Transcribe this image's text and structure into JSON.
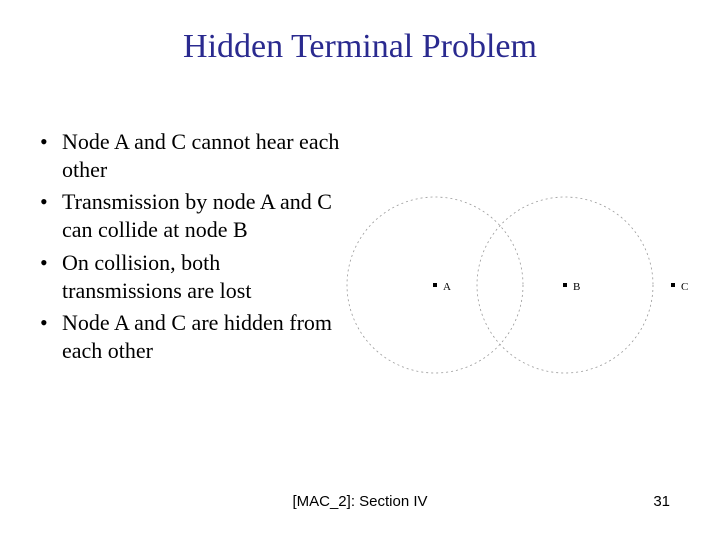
{
  "title": "Hidden Terminal Problem",
  "bullets": [
    "Node A and C cannot hear each other",
    "Transmission by node A and C can collide at node B",
    "On collision, both transmissions are lost",
    "Node A and C are hidden from each other"
  ],
  "figure": {
    "nodeA": "A",
    "nodeB": "B",
    "nodeC": "C"
  },
  "footer_ref": "[MAC_2]: Section IV",
  "page_number": "31"
}
